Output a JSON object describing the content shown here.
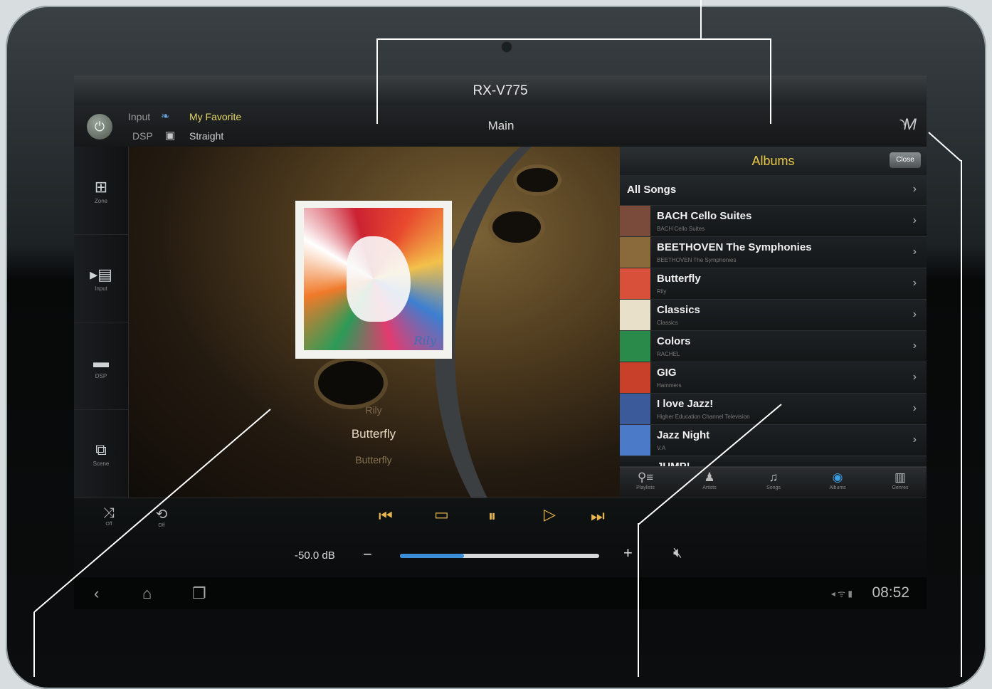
{
  "app": {
    "device_title": "RX-V775",
    "zone_label": "Main"
  },
  "status": {
    "input_label": "Input",
    "input_value": "My Favorite",
    "dsp_label": "DSP",
    "dsp_value": "Straight"
  },
  "sidebar": {
    "items": [
      {
        "label": "Zone",
        "icon": "zone-icon"
      },
      {
        "label": "Input",
        "icon": "input-icon"
      },
      {
        "label": "DSP",
        "icon": "dsp-icon"
      },
      {
        "label": "Scene",
        "icon": "scene-icon"
      }
    ]
  },
  "now_playing": {
    "artist": "Rily",
    "title": "Butterfly",
    "album": "Butterfly",
    "cover_signature": "Rily"
  },
  "albums_panel": {
    "title": "Albums",
    "close_label": "Close",
    "all_songs_label": "All Songs",
    "items": [
      {
        "name": "BACH Cello Suites",
        "sub": "BACH Cello Suites",
        "color": "#7a4a3a"
      },
      {
        "name": "BEETHOVEN  The Symphonies",
        "sub": "BEETHOVEN  The Symphonies",
        "color": "#8a6a3a"
      },
      {
        "name": "Butterfly",
        "sub": "Rily",
        "color": "#d8503a"
      },
      {
        "name": "Classics",
        "sub": "Classics",
        "color": "#e8e0c8"
      },
      {
        "name": "Colors",
        "sub": "RACHEL",
        "color": "#2a8a4a"
      },
      {
        "name": "GIG",
        "sub": "Hammers",
        "color": "#c8402a"
      },
      {
        "name": "I love Jazz!",
        "sub": "Higher Education Channel Television",
        "color": "#3a5a9a"
      },
      {
        "name": "Jazz Night",
        "sub": "V.A",
        "color": "#4a7ac8"
      }
    ],
    "partial_item": "JUMP!",
    "tabs": [
      {
        "label": "Playlists",
        "icon": "playlists-icon",
        "active": false
      },
      {
        "label": "Artists",
        "icon": "artists-icon",
        "active": false
      },
      {
        "label": "Songs",
        "icon": "songs-icon",
        "active": false
      },
      {
        "label": "Albums",
        "icon": "albums-icon",
        "active": true
      },
      {
        "label": "Genres",
        "icon": "genres-icon",
        "active": false
      }
    ]
  },
  "playback": {
    "shuffle_label": "Off",
    "repeat_label": "Off",
    "volume_text": "-50.0 dB",
    "volume_level": 0.32
  },
  "system": {
    "clock": "08:52"
  },
  "colors": {
    "accent": "#e8b64a",
    "panel_title": "#e8c94a",
    "volume_fill": "#3a8fd8"
  }
}
